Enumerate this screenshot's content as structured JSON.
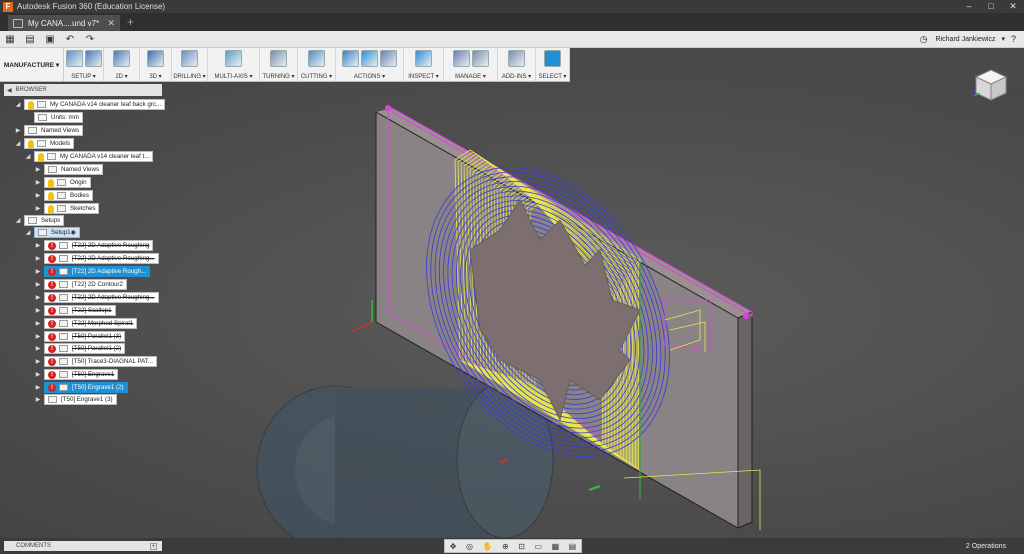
{
  "title_bar": {
    "text": "Autodesk Fusion 360 (Education License)",
    "controls": [
      "–",
      "□",
      "✕"
    ]
  },
  "document_tab": {
    "label": "My CANA....und v7*",
    "close": "✕"
  },
  "new_tab": "+",
  "qat": {
    "user": "Richard Jankiewicz",
    "user_caret": "▾",
    "help": "?"
  },
  "ribbon": {
    "workspace": "MANUFACTURE ▾",
    "groups": [
      {
        "label": "SETUP ▾",
        "icons": [
          "setup-folder-icon",
          "open-folder-icon"
        ]
      },
      {
        "label": "2D ▾",
        "icons": [
          "2d-toolpath-icon"
        ]
      },
      {
        "label": "3D ▾",
        "icons": [
          "3d-toolpath-icon"
        ]
      },
      {
        "label": "DRILLING ▾",
        "icons": [
          "drill-icon"
        ]
      },
      {
        "label": "MULTI-AXIS ▾",
        "icons": [
          "multi-axis-icon"
        ]
      },
      {
        "label": "TURNING ▾",
        "icons": [
          "turning-icon"
        ]
      },
      {
        "label": "CUTTING ▾",
        "icons": [
          "cutting-icon"
        ]
      },
      {
        "label": "ACTIONS ▾",
        "icons": [
          "simulate-icon",
          "g1g2-icon",
          "post-icon"
        ]
      },
      {
        "label": "INSPECT ▾",
        "icons": [
          "measure-icon"
        ]
      },
      {
        "label": "MANAGE ▾",
        "icons": [
          "tool-library-icon",
          "template-icon"
        ]
      },
      {
        "label": "ADD-INS ▾",
        "icons": [
          "scripts-icon"
        ]
      },
      {
        "label": "SELECT ▾",
        "icons": [
          "select-cursor-icon"
        ]
      }
    ]
  },
  "browser": {
    "header": "BROWSER",
    "expand": "◀"
  },
  "tree": [
    {
      "label": "My CANADA v14 cleaner leaf back grc...",
      "icon": "document-icon"
    },
    {
      "label": "Units: mm",
      "icon": "units-icon"
    },
    {
      "label": "Named Views",
      "icon": "folder-icon"
    },
    {
      "label": "Models",
      "icon": "folder-icon"
    },
    {
      "label": "My CANADA v14 cleaner leaf t...",
      "icon": "component-icon"
    },
    {
      "label": "Named Views",
      "icon": "folder-icon"
    },
    {
      "label": "Origin",
      "icon": "folder-icon"
    },
    {
      "label": "Bodies",
      "icon": "folder-icon"
    },
    {
      "label": "Sketches",
      "icon": "folder-icon"
    },
    {
      "label": "Setups",
      "icon": "setups-icon"
    },
    {
      "label": "Setup1",
      "icon": "setup-icon"
    },
    {
      "label": "[T22] 2D Adaptive Roughing",
      "icon": "adaptive-icon"
    },
    {
      "label": "[T22] 2D Adaptive Roughing...",
      "icon": "adaptive-icon"
    },
    {
      "label": "[T22] 2D Adaptive Rough...",
      "icon": "adaptive-icon"
    },
    {
      "label": "[T22] 2D Contour2",
      "icon": "contour-icon"
    },
    {
      "label": "[T22] 2D Adaptive Roughing...",
      "icon": "adaptive-icon"
    },
    {
      "label": "[T22] Scallop1",
      "icon": "scallop-icon"
    },
    {
      "label": "[T22] Morphed Spiral1",
      "icon": "spiral-icon"
    },
    {
      "label": "[T50] Parallel1 (3)",
      "icon": "parallel-icon"
    },
    {
      "label": "[T50] Parallel1 (2)",
      "icon": "parallel-icon"
    },
    {
      "label": "[T50] Trace3-DIAGNAL PAT...",
      "icon": "trace-icon"
    },
    {
      "label": "[T50] Engrave1",
      "icon": "engrave-icon"
    },
    {
      "label": "[T50] Engrave1 (2)",
      "icon": "engrave-icon"
    },
    {
      "label": "[T50] Engrave1 (3)",
      "icon": "engrave-icon"
    }
  ],
  "comments": {
    "label": "COMMENTS",
    "add": "+"
  },
  "status": {
    "operations": "2 Operations"
  },
  "colors": {
    "accent": "#1e90d6",
    "error": "#d62222",
    "toolpath_yellow": "#e8e84a",
    "toolpath_blue": "#3a3ad8",
    "stock_pink": "#e040e0"
  }
}
